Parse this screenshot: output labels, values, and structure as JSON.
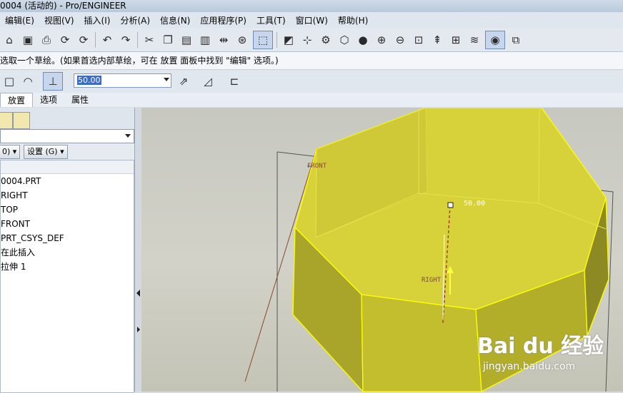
{
  "window": {
    "title": "0004 (活动的) - Pro/ENGINEER"
  },
  "menu": [
    "编辑(E)",
    "视图(V)",
    "插入(I)",
    "分析(A)",
    "信息(N)",
    "应用程序(P)",
    "工具(T)",
    "窗口(W)",
    "帮助(H)"
  ],
  "toolbar_icons": [
    "open-icon",
    "save-icon",
    "print-icon",
    "regenerate-icon",
    "undo-icon",
    "redo-icon",
    "cut-icon",
    "copy-icon",
    "paste-icon",
    "paste-special-icon",
    "binoculars-icon",
    "select-box-icon",
    "sketch-icon",
    "datum-points-icon",
    "axis-icon",
    "repaint-icon",
    "shading-icon",
    "zoom-in-icon",
    "zoom-out-icon",
    "zoom-fit-icon",
    "orient-icon",
    "named-views-icon",
    "layers-icon",
    "display-style-icon",
    "window-close-icon"
  ],
  "message": "选取一个草绘。(如果首选内部草绘，可在 放置 面板中找到 \"编辑\" 选项。)",
  "dashboard": {
    "depth_value": "50.00"
  },
  "tabs": [
    "放置",
    "选项",
    "属性"
  ],
  "tree": {
    "settings_button": "设置 (G)",
    "show_button": "0)",
    "items": [
      "0004.PRT",
      "RIGHT",
      "TOP",
      "FRONT",
      "PRT_CSYS_DEF",
      "在此插入",
      "拉伸 1"
    ]
  },
  "viewport": {
    "labels": {
      "front": "FRONT",
      "right": "RIGHT",
      "dimension": "50.00"
    },
    "colors": {
      "solid": "#dcdc3c",
      "edge": "#ffff00",
      "datum": "#8a4a2a"
    }
  },
  "watermark": {
    "logo": "Bai du 经验",
    "url": "jingyan.baidu.com"
  }
}
